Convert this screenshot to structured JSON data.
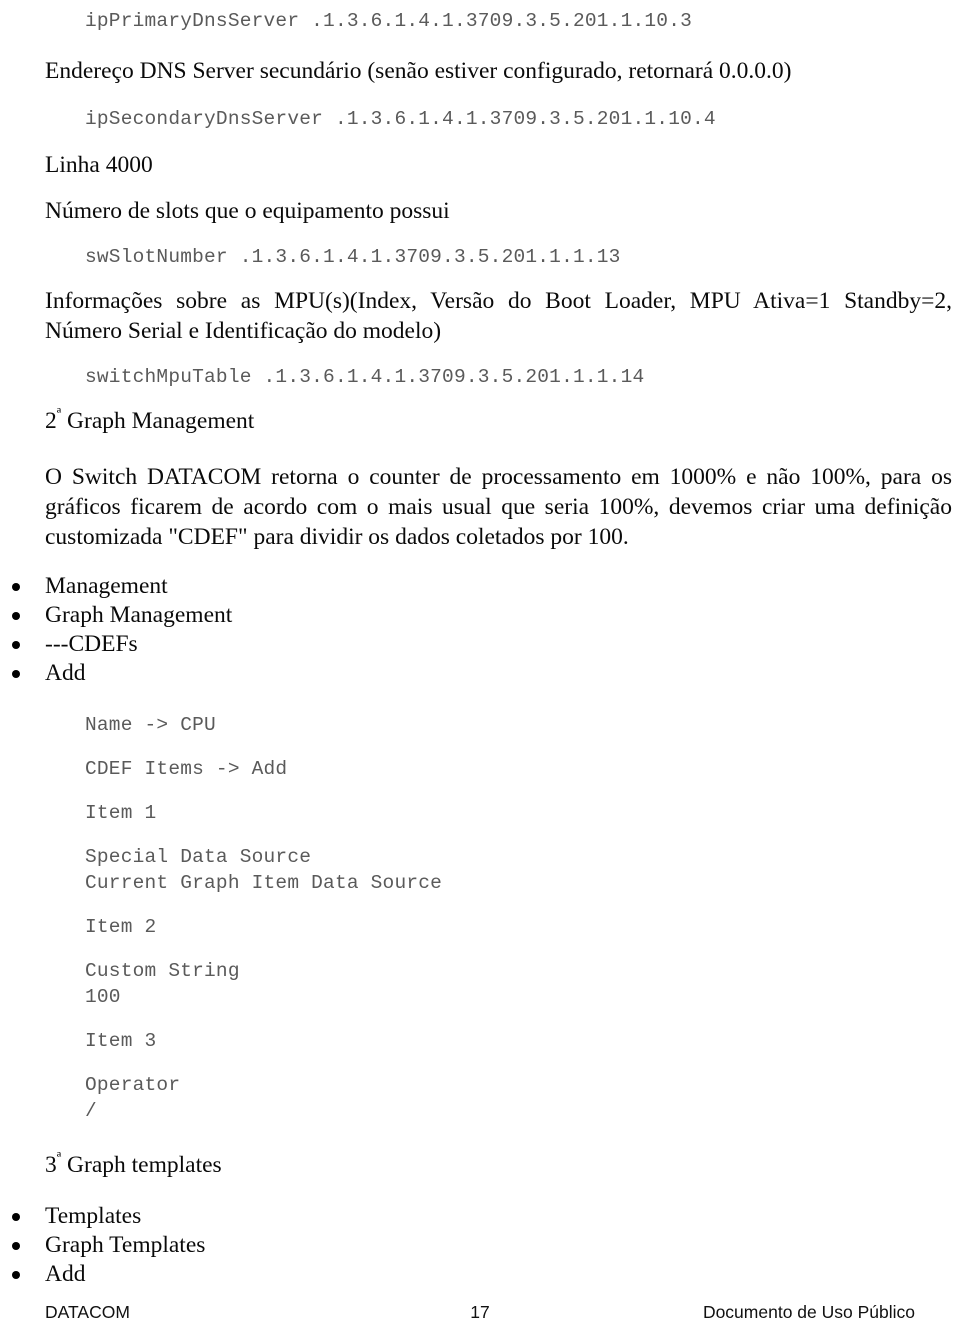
{
  "document": {
    "footer": {
      "left": "DATACOM",
      "page_number": "17",
      "right": "Documento de Uso Público"
    }
  },
  "blocks": {
    "oid_primary_dns": "ipPrimaryDnsServer .1.3.6.1.4.1.3709.3.5.201.1.10.3",
    "desc_secondary_dns": "Endereço DNS Server secundário (senão estiver configurado, retornará 0.0.0.0)",
    "oid_secondary_dns": "ipSecondaryDnsServer .1.3.6.1.4.1.3709.3.5.201.1.10.4",
    "heading_linha_4000": "Linha 4000",
    "desc_slots": "Número de slots que o equipamento possui",
    "oid_slot_number": "swSlotNumber .1.3.6.1.4.1.3709.3.5.201.1.1.13",
    "desc_mpu": "Informações sobre as MPU(s)(Index, Versão do Boot Loader, MPU Ativa=1 Standby=2, Número Serial e Identificação do modelo)",
    "oid_mpu_table": "switchMpuTable .1.3.6.1.4.1.3709.3.5.201.1.1.14",
    "heading_graph_management_ordinal": "2",
    "heading_graph_management_sup": "ª",
    "heading_graph_management_text": " Graph Management",
    "paragraph_cdef": "O Switch DATACOM retorna o counter de processamento em 1000% e não 100%, para os gráficos ficarem de acordo com o mais usual que seria 100%, devemos criar uma definição customizada \"CDEF\" para dividir os dados coletados por 100.",
    "heading_graph_templates_ordinal": "3",
    "heading_graph_templates_sup": "ª",
    "heading_graph_templates_text": " Graph templates"
  },
  "nav_list_cdef": [
    {
      "label": "Management"
    },
    {
      "label": "Graph Management"
    },
    {
      "label": "---CDEFs"
    },
    {
      "label": "Add"
    }
  ],
  "cdef_steps": {
    "name_line": "Name -> CPU",
    "cdef_items_line": "CDEF Items -> Add",
    "item1_label": "Item 1",
    "item1_field": "Special Data Source",
    "item1_value": "Current Graph Item Data Source",
    "item2_label": "Item 2",
    "item2_field": "Custom String",
    "item2_value": "100",
    "item3_label": "Item 3",
    "item3_field": "Operator",
    "item3_value": "/"
  },
  "nav_list_templates": [
    {
      "label": "Templates"
    },
    {
      "label": "Graph Templates"
    },
    {
      "label": "Add"
    }
  ]
}
